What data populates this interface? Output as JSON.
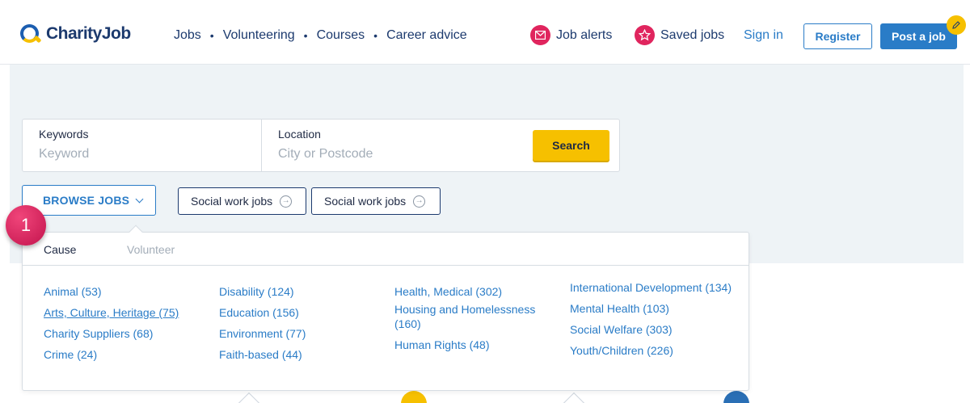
{
  "brand": {
    "name": "CharityJob"
  },
  "nav": {
    "items": [
      {
        "label": "Jobs"
      },
      {
        "label": "Volunteering"
      },
      {
        "label": "Courses"
      },
      {
        "label": "Career advice"
      }
    ],
    "separator": "•"
  },
  "header": {
    "job_alerts": "Job alerts",
    "saved_jobs": "Saved jobs",
    "sign_in": "Sign in",
    "register": "Register",
    "post_job": "Post a job"
  },
  "search": {
    "keywords_label": "Keywords",
    "keywords_placeholder": "Keyword",
    "location_label": "Location",
    "location_placeholder": "City or Postcode",
    "button": "Search"
  },
  "browse": {
    "label": "BROWSE JOBS"
  },
  "tags": [
    {
      "label": "Social work jobs"
    },
    {
      "label": "Social work jobs"
    }
  ],
  "step_badge": "1",
  "dropdown": {
    "tabs": [
      {
        "label": "Cause",
        "active": true
      },
      {
        "label": "Volunteer",
        "active": false
      }
    ],
    "columns": [
      [
        "Animal (53)",
        "Arts, Culture, Heritage (75)",
        "Charity Suppliers (68)",
        "Crime (24)"
      ],
      [
        "Disability (124)",
        "Education (156)",
        "Environment (77)",
        "Faith-based (44)"
      ],
      [
        "Health, Medical (302)",
        "Housing and Homelessness (160)",
        "Human Rights (48)"
      ],
      [
        "International Development (134)",
        "Mental Health (103)",
        "Social Welfare (303)",
        "Youth/Children (226)"
      ]
    ]
  },
  "colors": {
    "primary_blue": "#2a7cc7",
    "navy": "#1c3a6e",
    "yellow": "#f6c000",
    "pink": "#e0255e",
    "hero_bg": "#eef3f6"
  }
}
